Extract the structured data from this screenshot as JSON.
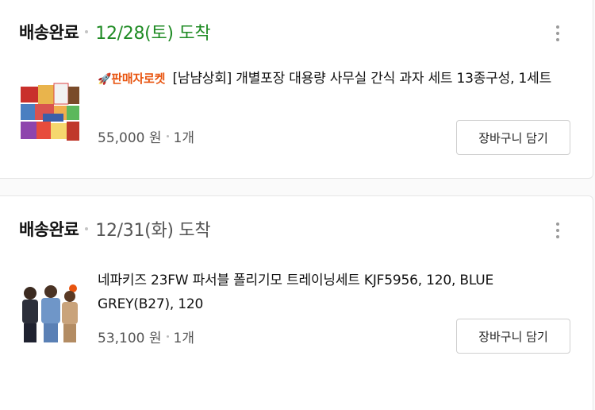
{
  "orders": [
    {
      "status": "배송완료",
      "date": "12/28(토) 도착",
      "date_color": "#1f8b24",
      "badge": "판매자로켓",
      "title": "[남냠상회] 개별포장 대용량 사무실 간식 과자 세트 13종구성, 1세트",
      "price": "55,000 원",
      "qty": "1개",
      "cart_label": "장바구니 담기",
      "image": "snack-box-set"
    },
    {
      "status": "배송완료",
      "date": "12/31(화) 도착",
      "date_color": "#555555",
      "title": "네파키즈 23FW 파서블 폴리기모 트레이닝세트 KJF5956, 120, BLUE GREY(B27), 120",
      "price": "53,100 원",
      "qty": "1개",
      "cart_label": "장바구니 담기",
      "image": "kids-training-set"
    }
  ]
}
